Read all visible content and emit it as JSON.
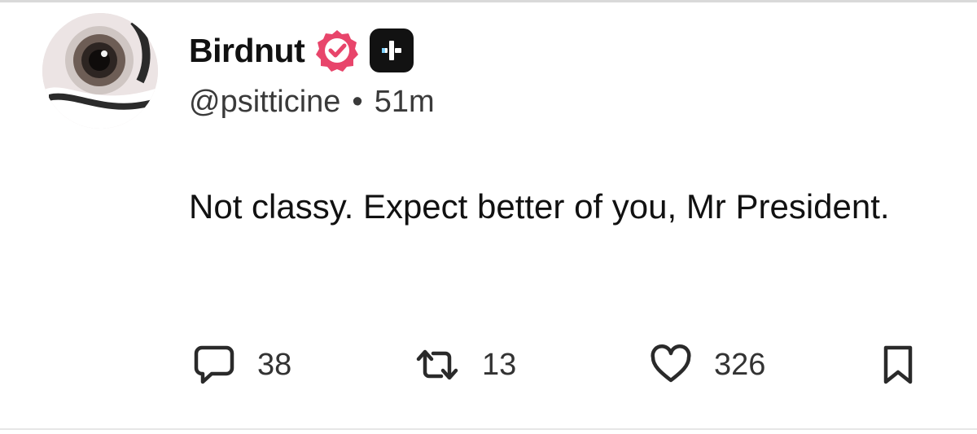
{
  "post": {
    "author": {
      "display_name": "Birdnut",
      "handle": "@psitticine",
      "avatar_icon": "avatar-photo-icon",
      "badges": [
        "verified-icon",
        "plus-badge-icon"
      ]
    },
    "timestamp": "51m",
    "separator": "•",
    "text": "Not classy. Expect better of you, Mr President.",
    "actions": {
      "replies": "38",
      "reposts": "13",
      "likes": "326"
    }
  },
  "colors": {
    "verified": "#e8456b",
    "badge_bg": "#121212",
    "text": "#111111",
    "muted": "#3a3a3a"
  }
}
